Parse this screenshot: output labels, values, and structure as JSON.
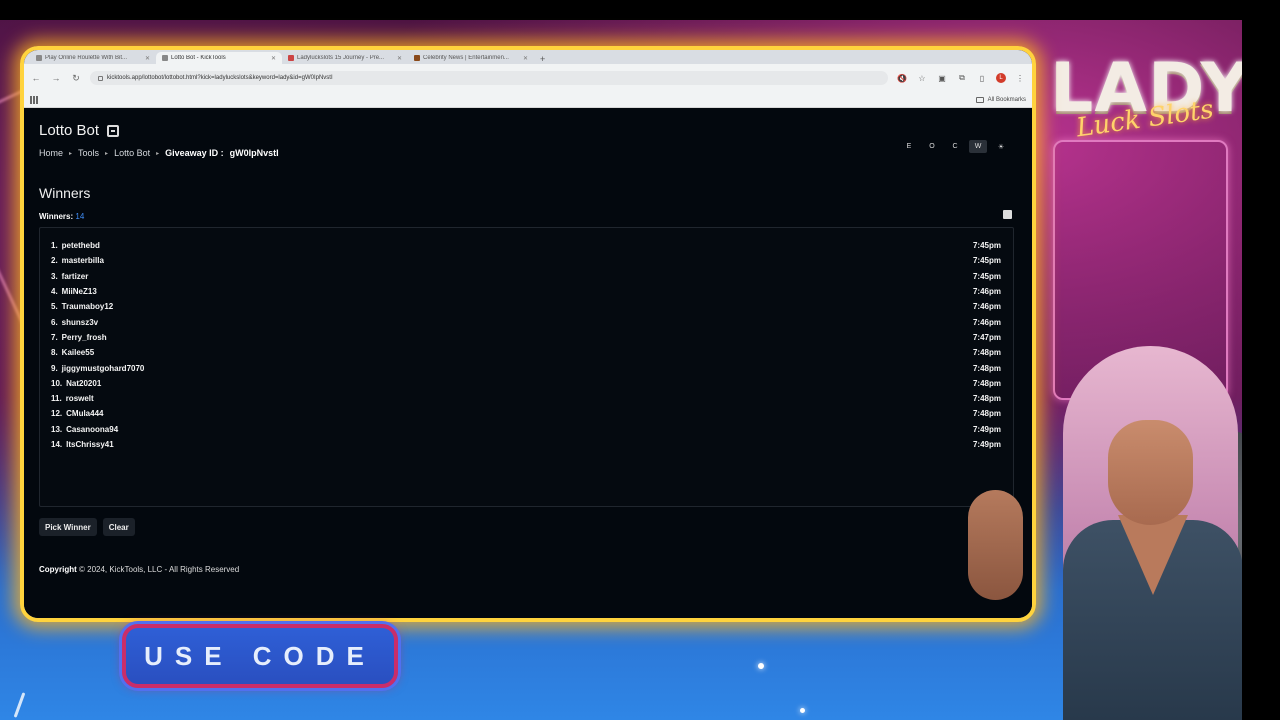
{
  "browser": {
    "tabs": [
      {
        "label": "Play Online Roulette With Bit...",
        "active": false
      },
      {
        "label": "Lotto Bot - KickTools",
        "active": true
      },
      {
        "label": "Ladyluckslots 15 Journey - Pre...",
        "active": false
      },
      {
        "label": "Celebrity News | Entertainmen...",
        "active": false
      }
    ],
    "new_tab": "+",
    "url": "kicktools.app/lottobot/lottobot.html?kick=ladyluckslots&keyword=lady&id=gW0IpNvstI",
    "all_bookmarks": "All Bookmarks",
    "profile_initial": "L"
  },
  "page": {
    "title": "Lotto Bot",
    "breadcrumbs": [
      "Home",
      "Tools",
      "Lotto Bot"
    ],
    "giveaway_label": "Giveaway ID :",
    "giveaway_id": "gW0IpNvstI",
    "theme_buttons": [
      "E",
      "O",
      "C",
      "W",
      "☀"
    ],
    "section_title": "Winners",
    "winners_label": "Winners:",
    "winners_count": "14",
    "winners": [
      {
        "rank": "1.",
        "name": "petethebd",
        "time": "7:45pm"
      },
      {
        "rank": "2.",
        "name": "masterbilla",
        "time": "7:45pm"
      },
      {
        "rank": "3.",
        "name": "fartizer",
        "time": "7:45pm"
      },
      {
        "rank": "4.",
        "name": "MiiNeZ13",
        "time": "7:46pm"
      },
      {
        "rank": "5.",
        "name": "Traumaboy12",
        "time": "7:46pm"
      },
      {
        "rank": "6.",
        "name": "shunsz3v",
        "time": "7:46pm"
      },
      {
        "rank": "7.",
        "name": "Perry_frosh",
        "time": "7:47pm"
      },
      {
        "rank": "8.",
        "name": "Kailee55",
        "time": "7:48pm"
      },
      {
        "rank": "9.",
        "name": "jiggymustgohard7070",
        "time": "7:48pm"
      },
      {
        "rank": "10.",
        "name": "Nat20201",
        "time": "7:48pm"
      },
      {
        "rank": "11.",
        "name": "roswelt",
        "time": "7:48pm"
      },
      {
        "rank": "12.",
        "name": "CMula444",
        "time": "7:48pm"
      },
      {
        "rank": "13.",
        "name": "Casanoona94",
        "time": "7:49pm"
      },
      {
        "rank": "14.",
        "name": "ItsChrissy41",
        "time": "7:49pm"
      }
    ],
    "pick_winner": "Pick Winner",
    "clear": "Clear",
    "copyright_label": "Copyright",
    "copyright_text": "© 2024, KickTools, LLC - All Rights Reserved"
  },
  "overlay": {
    "brand_main": "LADY",
    "brand_script": "Luck Slots",
    "use_code": "USE CODE"
  },
  "colors": {
    "frame_glow": "#ffd33d",
    "page_bg": "#03080e",
    "count_accent": "#3f8df7",
    "code_border": "#c92d6a",
    "code_fill": "#2e5fd6"
  }
}
